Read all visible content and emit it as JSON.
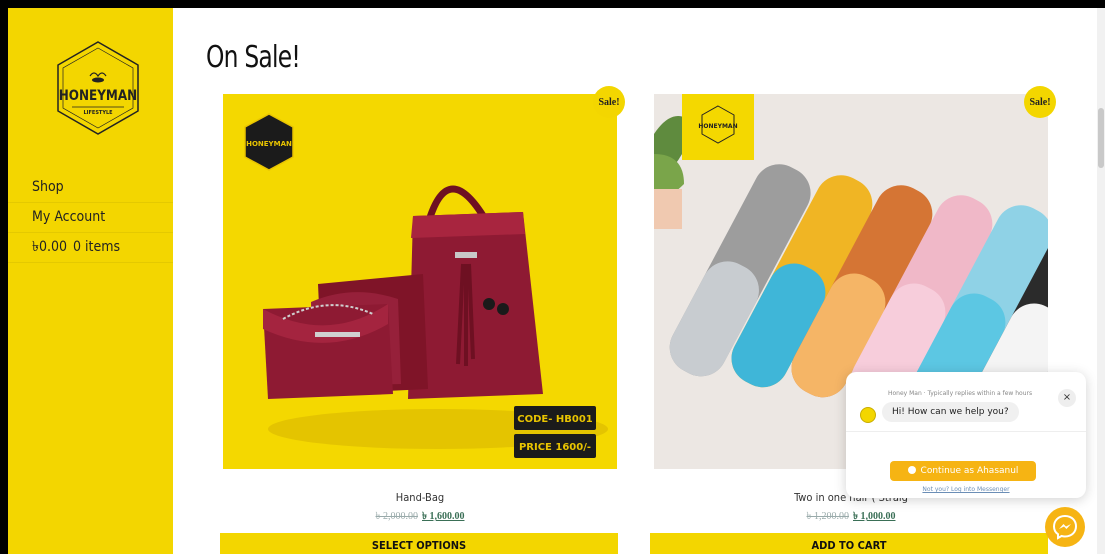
{
  "brand": {
    "line1": "HONEYMAN",
    "line2": "LIFESTYLE"
  },
  "nav": {
    "shop": "Shop",
    "account": "My Account",
    "cart_amount": "৳0.00",
    "cart_items": "0 items"
  },
  "page_title": "On Sale!",
  "products": [
    {
      "name": "Hand-Bag",
      "old_price": "৳ 2,000.00",
      "new_price": "৳ 1,600.00",
      "badge": "Sale!",
      "button": "SELECT OPTIONS",
      "code_label": "CODE- HB001",
      "price_label": "PRICE 1600/-"
    },
    {
      "name": "Two in one hair ( Straig",
      "old_price": "৳ 1,200.00",
      "new_price": "৳ 1,000.00",
      "badge": "Sale!",
      "button": "ADD TO CART"
    }
  ],
  "chat": {
    "header": "Honey Man · Typically replies within a few hours",
    "message": "Hi! How can we help you?",
    "continue": "Continue as Ahasanul",
    "link": "Not you? Log into Messenger",
    "close": "×"
  },
  "colors": {
    "brand_yellow": "#f3d600",
    "handbag": "#8e1a33",
    "messenger_orange": "#f6b413"
  }
}
